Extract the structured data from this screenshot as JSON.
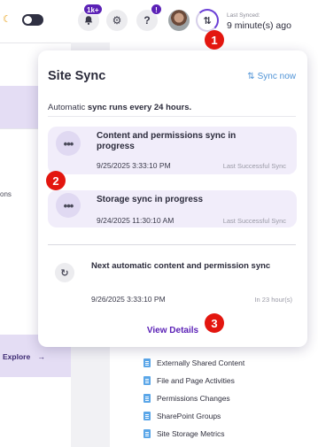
{
  "header": {
    "notifications_badge": "1k+",
    "help_badge": "!",
    "help_label": "?",
    "last_synced_label": "Last Synced:",
    "last_synced_value": "9 minute(s) ago"
  },
  "background": {
    "left_fragment": "ons",
    "explore_label": "Explore",
    "explore_arrow": "→",
    "report_links": [
      "Externally Shared Content",
      "File and Page Activities",
      "Permissions Changes",
      "SharePoint Groups",
      "Site Storage Metrics"
    ]
  },
  "popover": {
    "title": "Site Sync",
    "sync_now_icon": "⇅",
    "sync_now_label": "Sync now",
    "auto_prefix": "Automatic ",
    "auto_bold": "sync runs every 24 hours.",
    "in_progress": [
      {
        "title": "Content and permissions sync in progress",
        "date": "9/25/2025 3:33:10 PM",
        "status": "Last Successful Sync"
      },
      {
        "title": "Storage sync in progress",
        "date": "9/24/2025 11:30:10 AM",
        "status": "Last Successful Sync"
      }
    ],
    "next_sync": {
      "title": "Next automatic content and permission sync",
      "date": "9/26/2025 3:33:10 PM",
      "eta": "In 23 hour(s)"
    },
    "view_details_label": "View Details"
  },
  "markers": [
    "1",
    "2",
    "3"
  ],
  "colors": {
    "accent": "#5b21b6",
    "card_bg": "#f1edfa",
    "link_blue": "#4f93d6",
    "marker_red": "#e3160f"
  },
  "icons": {
    "theme": "moon-icon",
    "notifications": "bell-icon",
    "settings": "gear-icon",
    "help": "question-icon",
    "sync": "sync-arrows-icon",
    "in_progress": "more-dots-icon",
    "next_sync": "refresh-icon",
    "report": "document-icon"
  }
}
